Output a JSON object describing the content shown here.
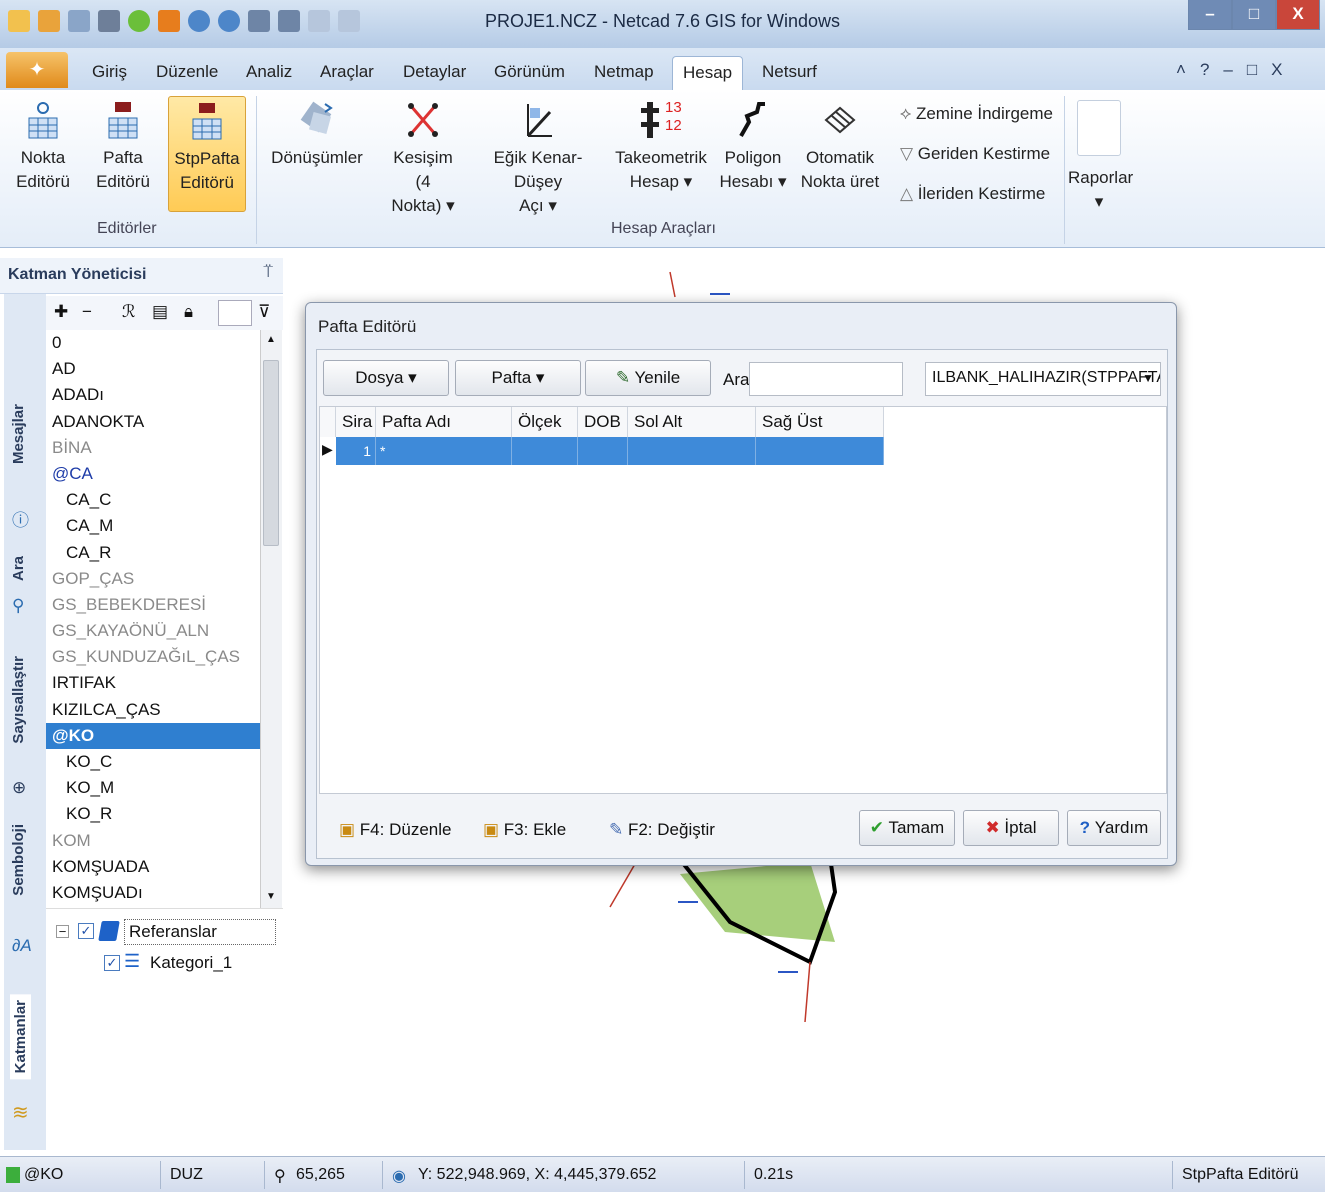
{
  "window": {
    "title": "PROJE1.NCZ - Netcad 7.6 GIS for Windows",
    "min": "–",
    "max": "□",
    "close": "X"
  },
  "ribbon_tabs": [
    "Giriş",
    "Düzenle",
    "Analiz",
    "Araçlar",
    "Detaylar",
    "Görünüm",
    "Netmap",
    "Hesap",
    "Netsurf"
  ],
  "active_tab": "Hesap",
  "mdi_controls": [
    "˄",
    "?",
    "–",
    "□",
    "X"
  ],
  "ribbon": {
    "editors": {
      "nokta": [
        "Nokta",
        "Editörü"
      ],
      "pafta": [
        "Pafta",
        "Editörü"
      ],
      "stppafta": [
        "StpPafta",
        "Editörü"
      ],
      "group_label": "Editörler"
    },
    "tools": {
      "donusumler": "Dönüşümler",
      "kesisim": [
        "Kesişim (4",
        "Nokta) ▾"
      ],
      "egik": [
        "Eğik Kenar-Düşey",
        "Açı ▾"
      ],
      "takeometrik": [
        "Takeometrik",
        "Hesap ▾"
      ],
      "takeo_numbers": [
        "13",
        "12"
      ],
      "poligon": [
        "Poligon",
        "Hesabı ▾"
      ],
      "otomatik": [
        "Otomatik",
        "Nokta üret"
      ],
      "zemine": "Zemine İndirgeme",
      "geriden": "Geriden Kestirme",
      "ileriden": "İleriden Kestirme",
      "group_label": "Hesap Araçları"
    },
    "raporlar": [
      "Raporlar",
      "▾"
    ]
  },
  "layer_manager": {
    "title": "Katman Yöneticisi",
    "pin": "⍡",
    "side_tabs": [
      "Mesajlar",
      "Ara",
      "Sayısallaştır",
      "Semboloji",
      "Katmanlar"
    ],
    "layers": [
      {
        "name": "0",
        "style": ""
      },
      {
        "name": "AD",
        "style": ""
      },
      {
        "name": "ADADı",
        "style": ""
      },
      {
        "name": "ADANOKTA",
        "style": ""
      },
      {
        "name": "BİNA",
        "style": "grey"
      },
      {
        "name": "@CA",
        "style": "blue"
      },
      {
        "name": "CA_C",
        "style": "sub"
      },
      {
        "name": "CA_M",
        "style": "sub"
      },
      {
        "name": "CA_R",
        "style": "sub"
      },
      {
        "name": "GOP_ÇAS",
        "style": "grey"
      },
      {
        "name": "GS_BEBEKDERESİ",
        "style": "grey"
      },
      {
        "name": "GS_KAYAÖNÜ_ALN",
        "style": "grey"
      },
      {
        "name": "GS_KUNDUZAĞıL_ÇAS",
        "style": "grey"
      },
      {
        "name": "IRTIFAK",
        "style": ""
      },
      {
        "name": "KIZILCA_ÇAS",
        "style": ""
      },
      {
        "name": "@KO",
        "style": "sel"
      },
      {
        "name": "KO_C",
        "style": "sub"
      },
      {
        "name": "KO_M",
        "style": "sub"
      },
      {
        "name": "KO_R",
        "style": "sub"
      },
      {
        "name": "KOM",
        "style": "grey"
      },
      {
        "name": "KOMŞUADA",
        "style": ""
      },
      {
        "name": "KOMŞUADı",
        "style": ""
      }
    ],
    "tree": {
      "root": "Referanslar",
      "child": "Kategori_1"
    }
  },
  "dialog": {
    "title": "Pafta Editörü",
    "dosya": "Dosya ▾",
    "pafta": "Pafta ▾",
    "yenile": "Yenile",
    "ara_label": "Ara",
    "ara_value": "",
    "combo": "ILBANK_HALIHAZIR(STPPAFTA",
    "columns": [
      "Sira",
      "Pafta Adı",
      "Ölçek",
      "DOB",
      "Sol Alt",
      "Sağ Üst"
    ],
    "row": {
      "sira": "1",
      "marker": "*"
    },
    "f4": "F4: Düzenle",
    "f3": "F3: Ekle",
    "f2": "F2: Değiştir",
    "tamam": "Tamam",
    "iptal": "İptal",
    "yardim": "Yardım"
  },
  "status": {
    "layer": "@KO",
    "mode": "DUZ",
    "zoom": "65,265",
    "coords": "Y: 522,948.969, X: 4,445,379.652",
    "time": "0.21s",
    "editor": "StpPafta Editörü"
  }
}
